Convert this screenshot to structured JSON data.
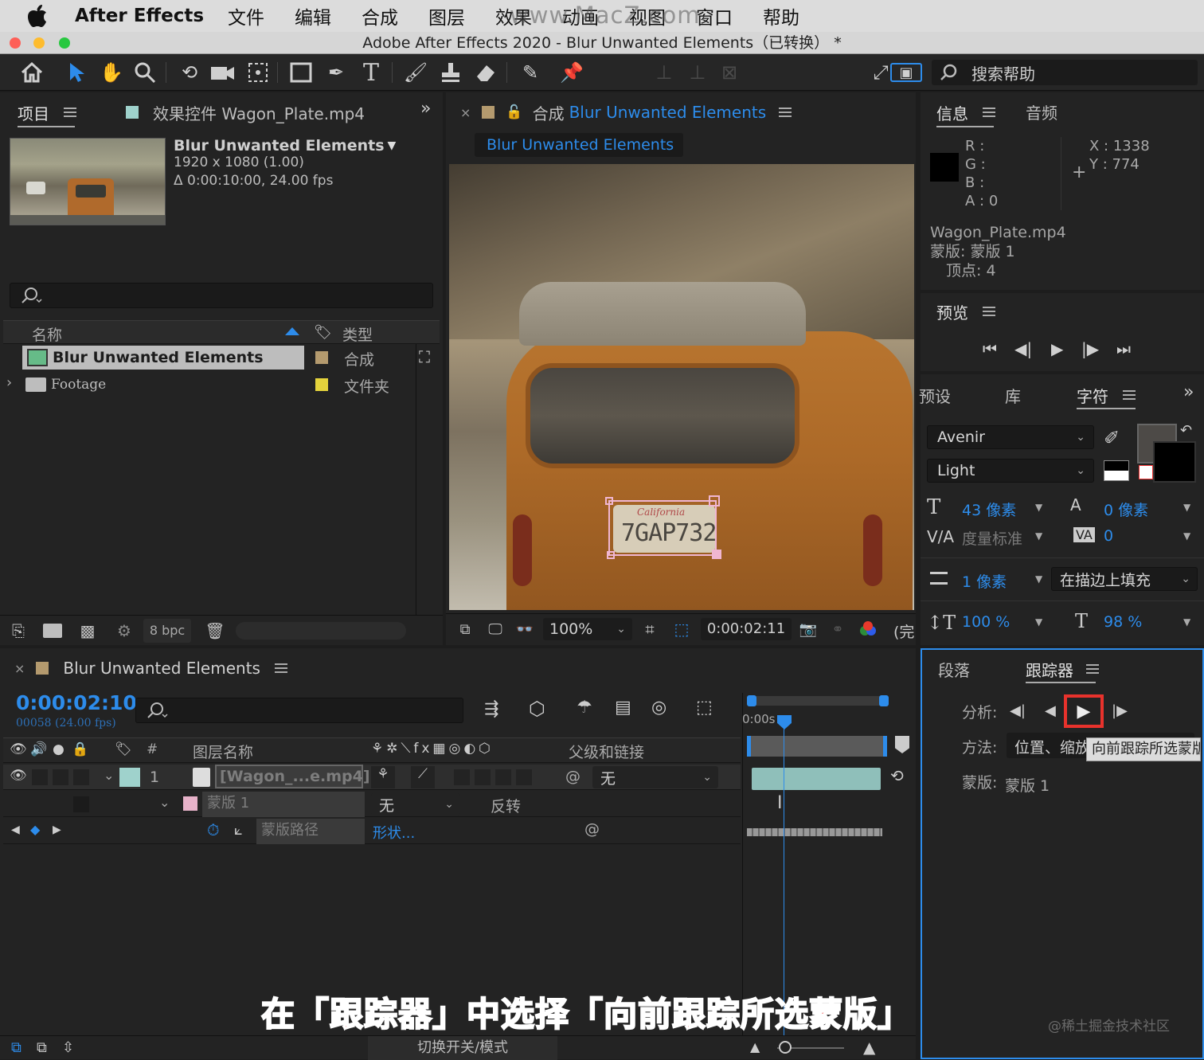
{
  "menubar": {
    "app_name": "After Effects",
    "items": [
      "文件",
      "编辑",
      "合成",
      "图层",
      "效果",
      "动画",
      "视图",
      "窗口",
      "帮助"
    ],
    "watermark": "www.MacZ.com"
  },
  "window": {
    "title": "Adobe After Effects 2020 - Blur Unwanted Elements（已转换） *"
  },
  "toolbar": {
    "align_label": "对齐",
    "search_help": "搜索帮助"
  },
  "project_panel": {
    "tab_project": "项目",
    "tab_effects": "效果控件 Wagon_Plate.mp4",
    "comp_name": "Blur Unwanted Elements",
    "comp_dims": "1920 x 1080 (1.00)",
    "comp_duration": "Δ 0:00:10:00, 24.00 fps",
    "col_name": "名称",
    "col_type": "类型",
    "items": [
      {
        "name": "Blur Unwanted Elements",
        "type": "合成",
        "color": "#b49a6e"
      },
      {
        "name": "Footage",
        "type": "文件夹",
        "color": "#e4d33c"
      }
    ],
    "bpc": "8 bpc"
  },
  "comp_panel": {
    "tab_prefix": "合成",
    "tab_name": "Blur Unwanted Elements",
    "breadcrumb": "Blur Unwanted Elements",
    "plate_text": "7GAP732",
    "plate_state": "California",
    "zoom": "100%",
    "timecode": "0:00:02:11",
    "quality_cut": "(完"
  },
  "info_panel": {
    "tab_info": "信息",
    "tab_audio": "音频",
    "r": "R :",
    "g": "G :",
    "b": "B :",
    "a": "A :  0",
    "x": "X : 1338",
    "y": "Y :  774",
    "file": "Wagon_Plate.mp4",
    "mask": "蒙版: 蒙版 1",
    "vertex": "顶点: 4"
  },
  "preview_panel": {
    "title": "预览"
  },
  "character_panel": {
    "tab_presets": "预设",
    "tab_library": "库",
    "tab_character": "字符",
    "font": "Avenir",
    "style": "Light",
    "size": "43 像素",
    "leading": "0 像素",
    "kerning": "度量标准",
    "tracking": "0",
    "stroke": "1 像素",
    "stroke_mode": "在描边上填充",
    "vscale": "100 %",
    "hscale": "98 %"
  },
  "timeline": {
    "tab_name": "Blur Unwanted Elements",
    "timecode": "0:00:02:10",
    "frame_info": "00058 (24.00 fps)",
    "col_num": "#",
    "col_layer_name": "图层名称",
    "col_parent": "父级和链接",
    "ruler_start": "0:00s",
    "layer": {
      "index": "1",
      "name": "[Wagon_...e.mp4]",
      "parent": "无",
      "label_color": "#9fd2cc"
    },
    "mask": {
      "name": "蒙版 1",
      "mode": "无",
      "invert": "反转",
      "color": "#e7b2c9"
    },
    "mask_path": {
      "name": "蒙版路径",
      "value": "形状..."
    },
    "footer_mode": "切换开关/模式"
  },
  "tracker_panel": {
    "tab_paragraph": "段落",
    "tab_tracker": "跟踪器",
    "analyze_label": "分析:",
    "method_label": "方法:",
    "method_value": "位置、缩放",
    "mask_label": "蒙版:",
    "mask_value": "蒙版 1",
    "tooltip": "向前跟踪所选蒙版"
  },
  "caption": "在「跟踪器」中选择「向前跟踪所选蒙版」",
  "credit": "@稀土掘金技术社区",
  "colors": {
    "accent": "#2d8ceb",
    "highlight_box": "#e8322c",
    "caption_fill": "#e8322c"
  }
}
